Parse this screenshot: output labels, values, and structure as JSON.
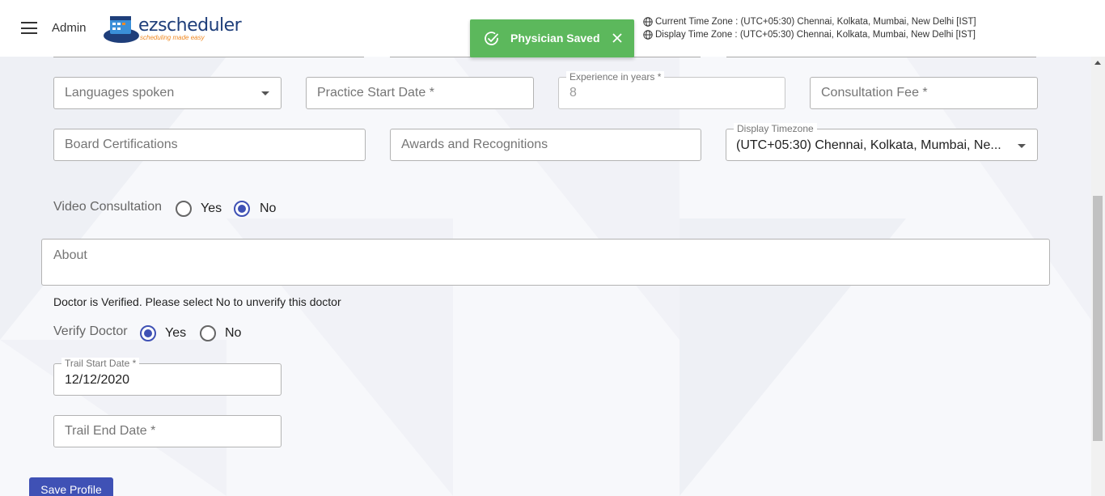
{
  "header": {
    "user_label": "Admin",
    "logo_text": "ezscheduler",
    "logo_tagline": "scheduling made easy",
    "current_tz": "Current Time Zone : (UTC+05:30) Chennai, Kolkata, Mumbai, New Delhi [IST]",
    "display_tz": "Display Time Zone : (UTC+05:30) Chennai, Kolkata, Mumbai, New Delhi [IST]"
  },
  "toast": {
    "message": "Physician Saved",
    "color": "#5cb85c"
  },
  "form": {
    "languages_placeholder": "Languages spoken",
    "practice_start_placeholder": "Practice Start Date *",
    "experience_label": "Experience in years *",
    "experience_value": "8",
    "consultation_fee_placeholder": "Consultation Fee  *",
    "board_cert_placeholder": "Board Certifications",
    "awards_placeholder": "Awards and Recognitions",
    "display_tz_label": "Display Timezone",
    "display_tz_value": "(UTC+05:30) Chennai, Kolkata, Mumbai, Ne...",
    "video_consult_label": "Video Consultation",
    "video_yes": "Yes",
    "video_no": "No",
    "video_selected": "No",
    "about_placeholder": "About",
    "verified_note": "Doctor is Verified. Please select No to unverify this doctor",
    "verify_label": "Verify Doctor",
    "verify_yes": "Yes",
    "verify_no": "No",
    "verify_selected": "Yes",
    "trail_start_label": "Trail Start Date *",
    "trail_start_value": "12/12/2020",
    "trail_end_placeholder": "Trail End Date *",
    "save_label": "Save Profile"
  },
  "colors": {
    "accent": "#3f51b5",
    "success": "#5cb85c"
  }
}
